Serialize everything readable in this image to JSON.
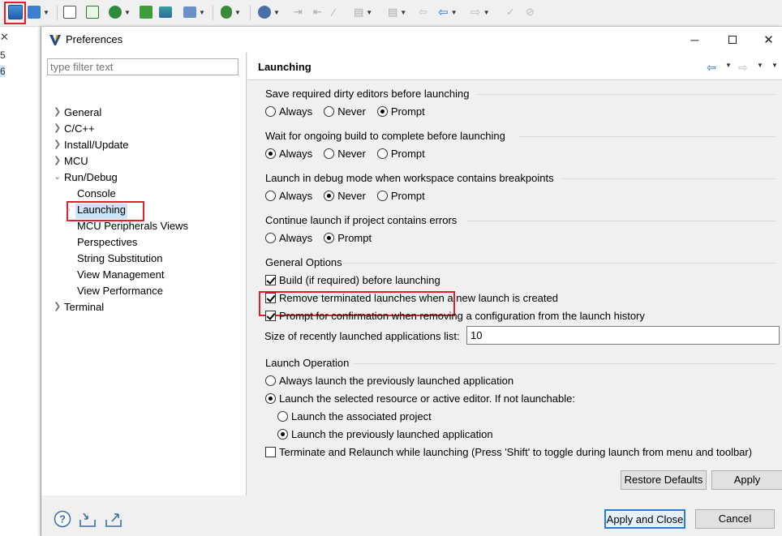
{
  "dialog": {
    "title": "Preferences",
    "filter_placeholder": "type filter text"
  },
  "ide_left": {
    "rows": [
      "5",
      "6"
    ]
  },
  "tree": {
    "general": "General",
    "cpp": "C/C++",
    "install_update": "Install/Update",
    "mcu": "MCU",
    "run_debug": "Run/Debug",
    "console": "Console",
    "launching": "Launching",
    "mcu_peripherals": "MCU Peripherals Views",
    "perspectives": "Perspectives",
    "string_substitution": "String Substitution",
    "view_management": "View Management",
    "view_performance": "View Performance",
    "terminal": "Terminal"
  },
  "page": {
    "title": "Launching",
    "save_dirty": {
      "label": "Save required dirty editors before launching",
      "options": [
        "Always",
        "Never",
        "Prompt"
      ],
      "selected": "Prompt"
    },
    "wait_build": {
      "label": "Wait for ongoing build to complete before launching",
      "options": [
        "Always",
        "Never",
        "Prompt"
      ],
      "selected": "Always"
    },
    "debug_mode": {
      "label": "Launch in debug mode when workspace contains breakpoints",
      "options": [
        "Always",
        "Never",
        "Prompt"
      ],
      "selected": "Never"
    },
    "continue_errors": {
      "label": "Continue launch if project contains errors",
      "options": [
        "Always",
        "Prompt"
      ],
      "selected": "Prompt"
    },
    "general_options": {
      "label": "General Options",
      "build_before": "Build (if required) before launching",
      "remove_terminated": "Remove terminated launches when a new launch is created",
      "prompt_confirm": "Prompt for confirmation when removing a configuration from the launch history",
      "history_size_label": "Size of recently launched applications list:",
      "history_size_value": "10"
    },
    "launch_operation": {
      "label": "Launch Operation",
      "always_previous": "Always launch the previously launched application",
      "launch_selected": "Launch the selected resource or active editor. If not launchable:",
      "launch_associated": "Launch the associated project",
      "launch_previous": "Launch the previously launched application",
      "terminate_relaunch": "Terminate and Relaunch while launching (Press 'Shift' to toggle during launch from menu and toolbar)"
    },
    "restore_defaults": "Restore Defaults",
    "apply": "Apply"
  },
  "footer": {
    "apply_close": "Apply and Close",
    "cancel": "Cancel"
  },
  "icons": {
    "help": "help-icon",
    "import": "import-icon",
    "export": "export-icon"
  },
  "colors": {
    "highlight": "#e0202a",
    "selection": "#cce4f7"
  }
}
